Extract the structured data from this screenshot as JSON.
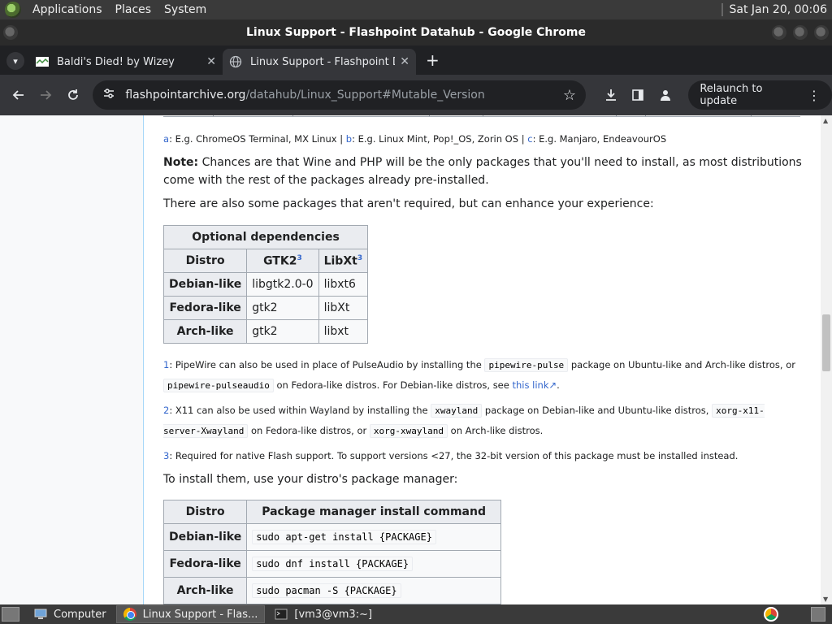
{
  "top_panel": {
    "menus": [
      "Applications",
      "Places",
      "System"
    ],
    "clock": "Sat Jan 20, 00:06"
  },
  "window": {
    "title": "Linux Support - Flashpoint Datahub - Google Chrome"
  },
  "tabs": [
    {
      "title": "Baldi's Died! by Wizey",
      "close": "✕"
    },
    {
      "title": "Linux Support - Flashpoint Datahub",
      "close": "✕"
    }
  ],
  "toolbar": {
    "url_host": "flashpointarchive.org",
    "url_path": "/datahub/Linux_Support#Mutable_Version",
    "relaunch_label": "Relaunch to update"
  },
  "page": {
    "footnote_abc": {
      "a_key": "a",
      "a_text": ": E.g. ChromeOS Terminal, MX Linux | ",
      "b_key": "b",
      "b_text": ": E.g. Linux Mint, Pop!_OS, Zorin OS | ",
      "c_key": "c",
      "c_text": ": E.g. Manjaro, EndeavourOS"
    },
    "note_label": "Note:",
    "note_text": " Chances are that Wine and PHP will be the only packages that you'll need to install, as most distributions come with the rest of the packages already pre-installed.",
    "optional_intro": "There are also some packages that aren't required, but can enhance your experience:",
    "optional_table": {
      "caption": "Optional dependencies",
      "headers": [
        "Distro",
        "GTK2",
        "LibXt"
      ],
      "header_sup": "3",
      "rows": [
        [
          "Debian-like",
          "libgtk2.0-0",
          "libxt6"
        ],
        [
          "Fedora-like",
          "gtk2",
          "libXt"
        ],
        [
          "Arch-like",
          "gtk2",
          "libxt"
        ]
      ]
    },
    "fn1": {
      "key": "1",
      "t1": ": PipeWire can also be used in place of PulseAudio by installing the ",
      "c1": "pipewire-pulse",
      "t2": " package on Ubuntu-like and Arch-like distros, or ",
      "c2": "pipewire-pulseaudio",
      "t3": " on Fedora-like distros. For Debian-like distros, see ",
      "link": "this link",
      "t4": "."
    },
    "fn2": {
      "key": "2",
      "t1": ": X11 can also be used within Wayland by installing the ",
      "c1": "xwayland",
      "t2": " package on Debian-like and Ubuntu-like distros, ",
      "c2": "xorg-x11-server-Xwayland",
      "t3": " on Fedora-like distros, or ",
      "c3": "xorg-xwayland",
      "t4": " on Arch-like distros."
    },
    "fn3": {
      "key": "3",
      "text": ": Required for native Flash support. To support versions <27, the 32-bit version of this package must be installed instead."
    },
    "install_intro": "To install them, use your distro's package manager:",
    "install_table": {
      "headers": [
        "Distro",
        "Package manager install command"
      ],
      "rows": [
        [
          "Debian-like",
          "sudo apt-get install {PACKAGE}"
        ],
        [
          "Fedora-like",
          "sudo dnf install {PACKAGE}"
        ],
        [
          "Arch-like",
          "sudo pacman -S {PACKAGE}"
        ]
      ]
    }
  },
  "taskbar": {
    "items": [
      "Computer",
      "Linux Support - Flas...",
      "[vm3@vm3:~]"
    ]
  },
  "icons": {
    "back": "back-arrow-icon",
    "forward": "forward-arrow-icon",
    "reload": "reload-icon",
    "bookmark": "star-icon",
    "download": "download-icon",
    "sidepanel": "side-panel-icon",
    "profile": "profile-icon"
  },
  "colors": {
    "link": "#3366cc",
    "toolbar": "#35363a",
    "tabstrip": "#202124",
    "panel": "#3a3a3a"
  }
}
